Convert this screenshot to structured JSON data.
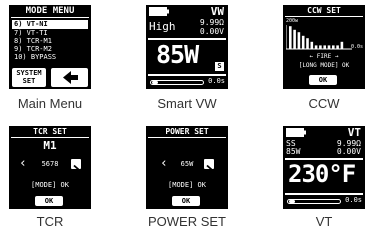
{
  "screens": {
    "main_menu": {
      "title": "MODE MENU",
      "items": [
        "6) VT-NI",
        "7) VT-TI",
        "8) TCR-M1",
        "9) TCR-M2",
        "10) BYPASS"
      ],
      "system_set_label": "SYSTEM\nSET",
      "caption": "Main Menu"
    },
    "smart_vw": {
      "mode": "VW",
      "level": "High",
      "resistance": "9.99Ω",
      "voltage": "0.00V",
      "power": "85W",
      "s_badge": "S",
      "timer": "0.0s",
      "caption": "Smart VW"
    },
    "ccw": {
      "title": "CCW SET",
      "y_label": "200w",
      "time_label": "0.0s",
      "fire_label": "FIRE",
      "long_mode": "[LONG MODE] OK",
      "ok_label": "OK",
      "bar_levels": [
        0.95,
        0.8,
        0.7,
        0.55,
        0.45,
        0.3,
        0.15,
        0.15,
        0.15,
        0.15,
        0.15,
        0.15,
        0.3
      ],
      "caption": "CCW"
    },
    "tcr": {
      "title": "TCR SET",
      "slot": "M1",
      "value": "5678",
      "mode_line": "[MODE] OK",
      "ok_label": "OK",
      "caption": "TCR"
    },
    "power_set": {
      "title": "POWER SET",
      "value": "65W",
      "mode_line": "[MODE] OK",
      "ok_label": "OK",
      "caption": "POWER SET"
    },
    "vt": {
      "mode": "VT",
      "material": "SS",
      "resistance": "9.99Ω",
      "power": "85W",
      "voltage": "0.00V",
      "temperature": "230",
      "unit": "°F",
      "timer": "0.0s",
      "caption": "VT"
    }
  },
  "colors": {
    "screen_bg": "#000000",
    "screen_fg": "#ffffff",
    "caption": "#333333"
  }
}
